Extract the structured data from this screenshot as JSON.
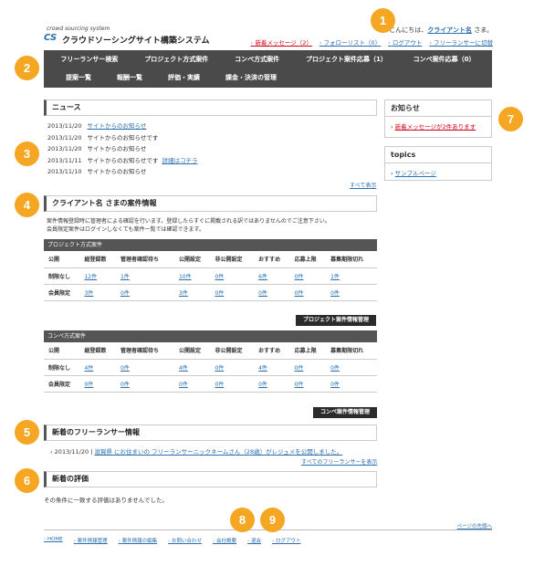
{
  "colors": {
    "accent": "#f5a623",
    "menu_bg": "#4a4a4a",
    "link": "#2a6fb0",
    "alert": "#d0021b"
  },
  "header": {
    "logo_tagline": "crowd sourcing system",
    "logo_mark": "CS",
    "logo_title": "クラウドソーシングサイト構築システム",
    "greeting_prefix": "こんにちは、",
    "user_name": "クライアント名",
    "greeting_suffix": " さま。",
    "nav": [
      "新着メッセージ（2）",
      "フォローリスト（0）",
      "ログアウト",
      "フリーランサーに切替"
    ]
  },
  "menu": {
    "row1": [
      "フリーランサー検索",
      "プロジェクト方式案件",
      "コンペ方式案件",
      "プロジェクト案件応募（1）",
      "コンペ案件応募（0）"
    ],
    "row2": [
      "提案一覧",
      "報酬一覧",
      "評価・実績",
      "課金・決済の管理"
    ]
  },
  "news": {
    "title": "ニュース",
    "items": [
      {
        "date": "2013/11/20",
        "text": "サイトからのお知らせ",
        "link": true,
        "extra": ""
      },
      {
        "date": "2013/11/20",
        "text": "サイトからのお知らせです",
        "link": false,
        "extra": ""
      },
      {
        "date": "2013/11/20",
        "text": "サイトからのお知らせ",
        "link": false,
        "extra": ""
      },
      {
        "date": "2013/11/11",
        "text": "サイトからのお知らせです",
        "link": false,
        "extra": "詳細はコチラ"
      },
      {
        "date": "2013/11/10",
        "text": "サイトからのお知らせ",
        "link": false,
        "extra": ""
      }
    ],
    "more": "すべて表示"
  },
  "client": {
    "title": "クライアント名 さまの案件情報",
    "desc1": "案件情報登録時に管理者による確認を行います。登録したらすぐに掲載される訳ではありませんのでご注意下さい。",
    "desc2": "会員限定案件はログインしなくても案件一覧では確認できます。",
    "headers": [
      "公開",
      "総登録数",
      "管理者確認待ち",
      "公開設定",
      "非公開設定",
      "おすすめ",
      "応募上限",
      "募集期限切れ"
    ],
    "project": {
      "label": "プロジェクト方式案件",
      "rows": [
        [
          "制限なし",
          "12件",
          "1件",
          "10件",
          "0件",
          "6件",
          "0件",
          "1件"
        ],
        [
          "会員限定",
          "3件",
          "0件",
          "3件",
          "0件",
          "0件",
          "0件",
          "0件"
        ]
      ],
      "button": "プロジェクト案件情報管理"
    },
    "compe": {
      "label": "コンペ方式案件",
      "rows": [
        [
          "制限なし",
          "4件",
          "0件",
          "4件",
          "0件",
          "4件",
          "0件",
          "0件"
        ],
        [
          "会員限定",
          "0件",
          "0件",
          "0件",
          "0件",
          "0件",
          "0件",
          "0件"
        ]
      ],
      "button": "コンペ案件情報管理"
    }
  },
  "freelancer": {
    "title": "新着のフリーランサー情報",
    "date": "2013/11/20",
    "text": "滋賀県 にお住まいの フリーランサーニックネームさん（28歳）がレジュメを公開しました。",
    "more": "すべてのフリーランサーを表示"
  },
  "evaluation": {
    "title": "新着の評価",
    "empty": "その条件に一致する評価はありませんでした。"
  },
  "sidebar": {
    "notice_title": "お知らせ",
    "notice_text": "新着メッセージが2件あります",
    "topics_title": "topics",
    "topics_item": "サンプルページ"
  },
  "footer": {
    "pagetop": "ページの先頭へ",
    "nav": [
      "HOME",
      "案件情報管理",
      "案件情報の編集",
      "お問い合わせ",
      "会社概要",
      "退会",
      "ログアウト"
    ]
  },
  "badges": [
    "1",
    "2",
    "3",
    "4",
    "5",
    "6",
    "7",
    "8",
    "9"
  ]
}
